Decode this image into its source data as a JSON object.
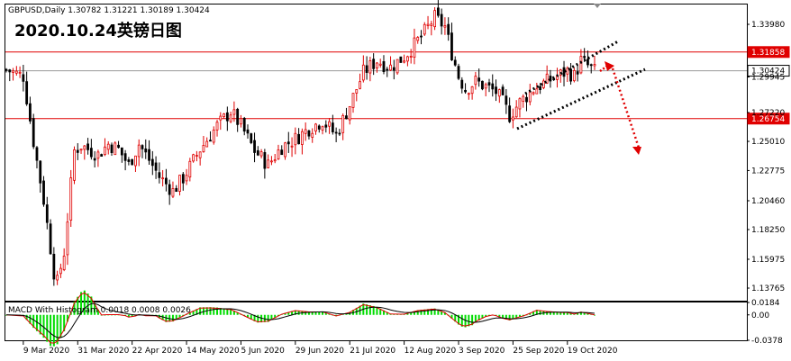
{
  "header": {
    "symbol_info": "GBPUSD,Daily  1.30782  1.31221  1.30189  1.30424",
    "overlay_title": "2020.10.24英镑日图"
  },
  "price_axis": {
    "ticks": [
      "1.33980",
      "1.29945",
      "1.27220",
      "1.25010",
      "1.22775",
      "1.20460",
      "1.18250",
      "1.15975",
      "1.13765"
    ],
    "tick_values": [
      1.3398,
      1.29945,
      1.2722,
      1.2501,
      1.22775,
      1.2046,
      1.1825,
      1.15975,
      1.13765
    ]
  },
  "levels": [
    {
      "label": "1.31858",
      "value": 1.31858,
      "color": "#e00000"
    },
    {
      "label": "1.30424",
      "value": 1.30424,
      "color": "#999999"
    },
    {
      "label": "1.26754",
      "value": 1.26754,
      "color": "#e00000"
    }
  ],
  "date_axis": {
    "labels": [
      "9 Mar 2020",
      "31 Mar 2020",
      "22 Apr 2020",
      "14 May 2020",
      "5 Jun 2020",
      "29 Jun 2020",
      "21 Jul 2020",
      "12 Aug 2020",
      "3 Sep 2020",
      "25 Sep 2020",
      "19 Oct 2020"
    ]
  },
  "macd": {
    "label": "MACD With Histogram 0.0018 0.0008 0.0026",
    "ticks": [
      "0.0184",
      "0.00",
      "-0.0378"
    ],
    "tick_values": [
      0.0184,
      0.0,
      -0.0378
    ]
  },
  "colors": {
    "up_candle": "#e00000",
    "down_candle": "#000000",
    "support_resistance": "#e00000",
    "current_price": "#999999",
    "channel": "#000000",
    "forecast_arrow": "#e00000",
    "macd_hist": "#00dd00",
    "macd_line": "#e00000",
    "signal_line": "#000000"
  },
  "chart_data": {
    "type": "candlestick",
    "title": "2020.10.24英镑日图",
    "symbol": "GBPUSD",
    "timeframe": "Daily",
    "last_bar": {
      "open": 1.30782,
      "high": 1.31221,
      "low": 1.30189,
      "close": 1.30424
    },
    "x": [
      "2020-03-09",
      "2020-03-31",
      "2020-04-22",
      "2020-05-14",
      "2020-06-05",
      "2020-06-29",
      "2020-07-21",
      "2020-08-12",
      "2020-09-03",
      "2020-09-25",
      "2020-10-19"
    ],
    "close": [
      1.3,
      1.24,
      1.244,
      1.22,
      1.265,
      1.232,
      1.272,
      1.305,
      1.325,
      1.288,
      1.304
    ],
    "anchor_lows": [
      {
        "date": "2020-03-20",
        "value": 1.1409
      }
    ],
    "anchor_highs": [
      {
        "date": "2020-09-01",
        "value": 1.3482
      }
    ],
    "horizontal_levels": [
      1.31858,
      1.26754
    ],
    "current_price": 1.30424,
    "ylim": [
      1.128,
      1.355
    ],
    "macd": {
      "macd": 0.0018,
      "signal": 0.0008,
      "histogram": 0.0026,
      "ylim": [
        -0.0378,
        0.0184
      ]
    }
  }
}
